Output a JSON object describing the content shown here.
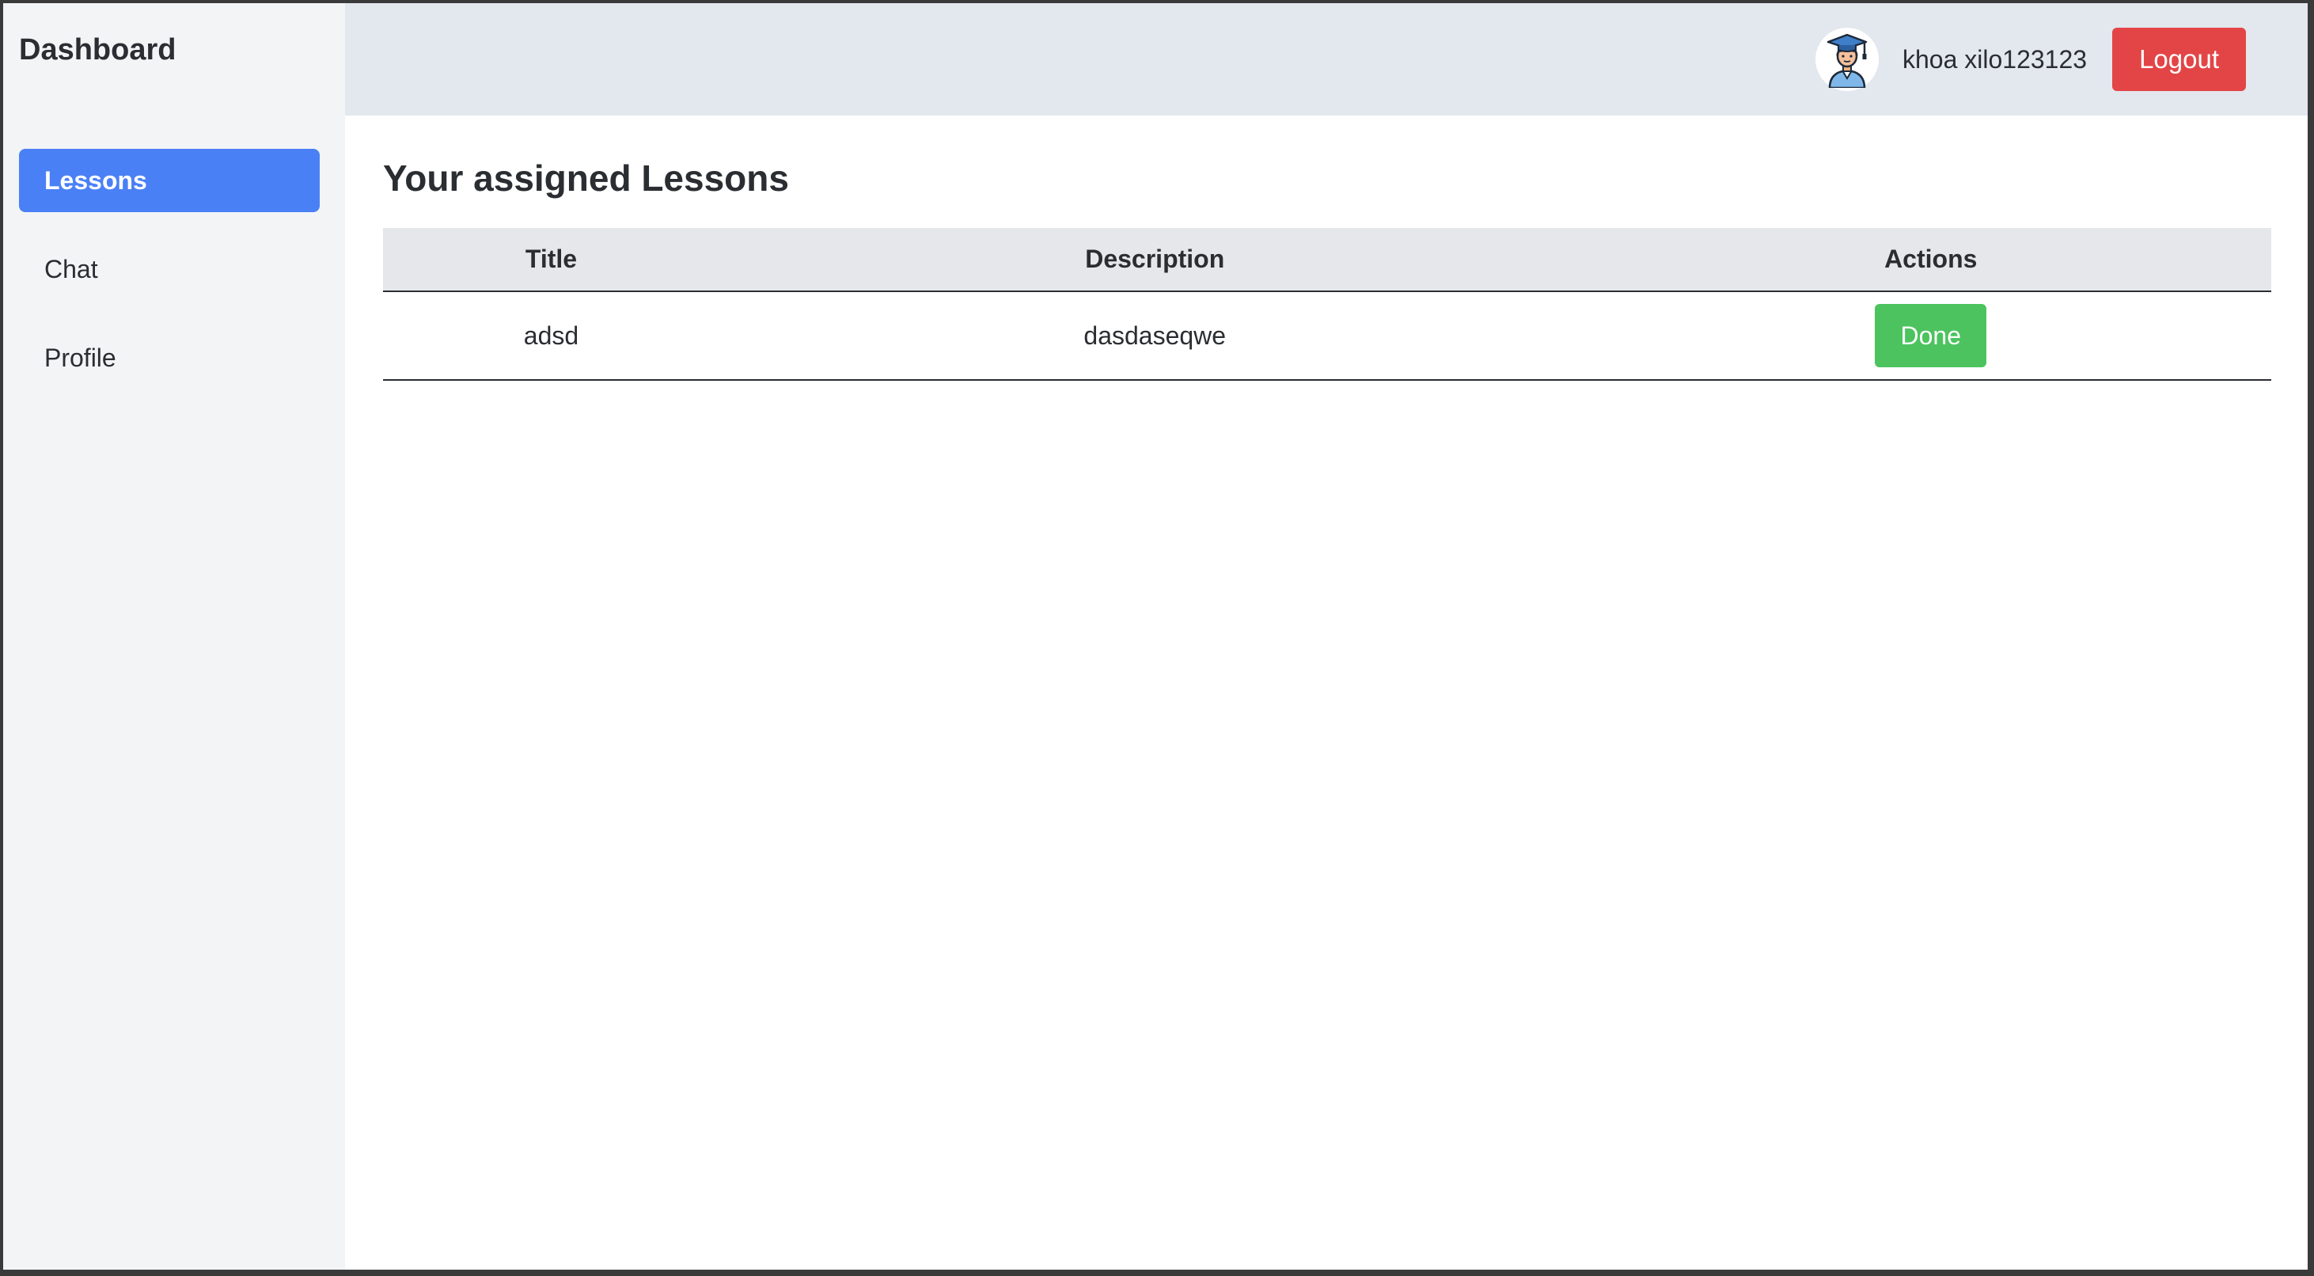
{
  "sidebar": {
    "brand": "Dashboard",
    "items": [
      {
        "label": "Lessons",
        "active": true
      },
      {
        "label": "Chat",
        "active": false
      },
      {
        "label": "Profile",
        "active": false
      }
    ]
  },
  "header": {
    "avatar_icon": "student-graduate-avatar-icon",
    "username": "khoa xilo123123",
    "logout_label": "Logout"
  },
  "main": {
    "title": "Your assigned Lessons",
    "table": {
      "columns": [
        "Title",
        "Description",
        "Actions"
      ],
      "rows": [
        {
          "title": "adsd",
          "description": "dasdaseqwe",
          "action_label": "Done"
        }
      ]
    }
  },
  "colors": {
    "accent": "#4a80f6",
    "logout": "#e34546",
    "done": "#4cc35e",
    "sidebar_bg": "#f2f4f6",
    "topbar_bg": "#e3e7ee"
  }
}
